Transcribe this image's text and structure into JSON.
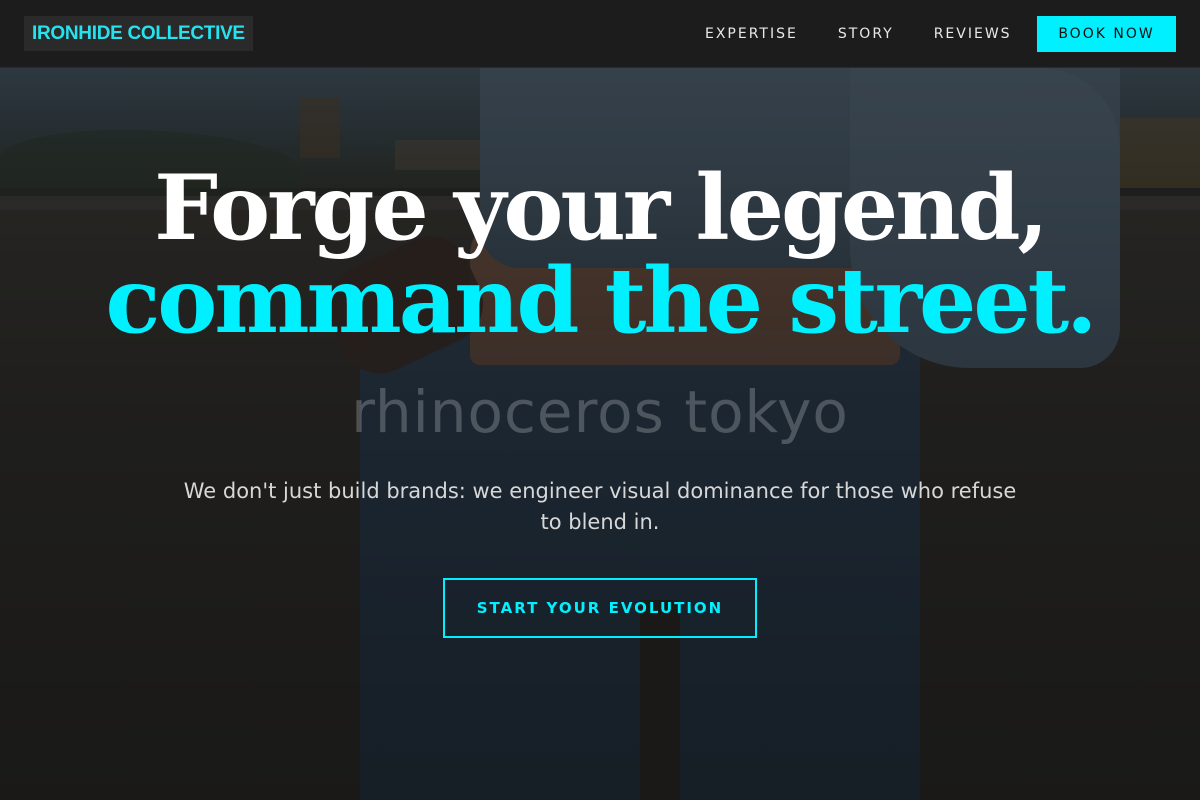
{
  "brand": {
    "logo_text": "IRONHIDE COLLECTIVE"
  },
  "nav": {
    "links": [
      {
        "label": "EXPERTISE"
      },
      {
        "label": "STORY"
      },
      {
        "label": "REVIEWS"
      }
    ],
    "cta_label": "BOOK NOW"
  },
  "hero": {
    "headline_line1": "Forge your legend,",
    "headline_accent": "command the street.",
    "subtitle": "We don't just build brands: we engineer visual dominance for those who refuse to blend in.",
    "cta_label": "START YOUR EVOLUTION",
    "watermark": "rhinoceros tokyo"
  },
  "colors": {
    "accent": "#00f0ff",
    "nav_background": "#1c1c1c",
    "headline_white": "#ffffff",
    "subtitle_text": "#d7d7d7"
  },
  "icons": []
}
